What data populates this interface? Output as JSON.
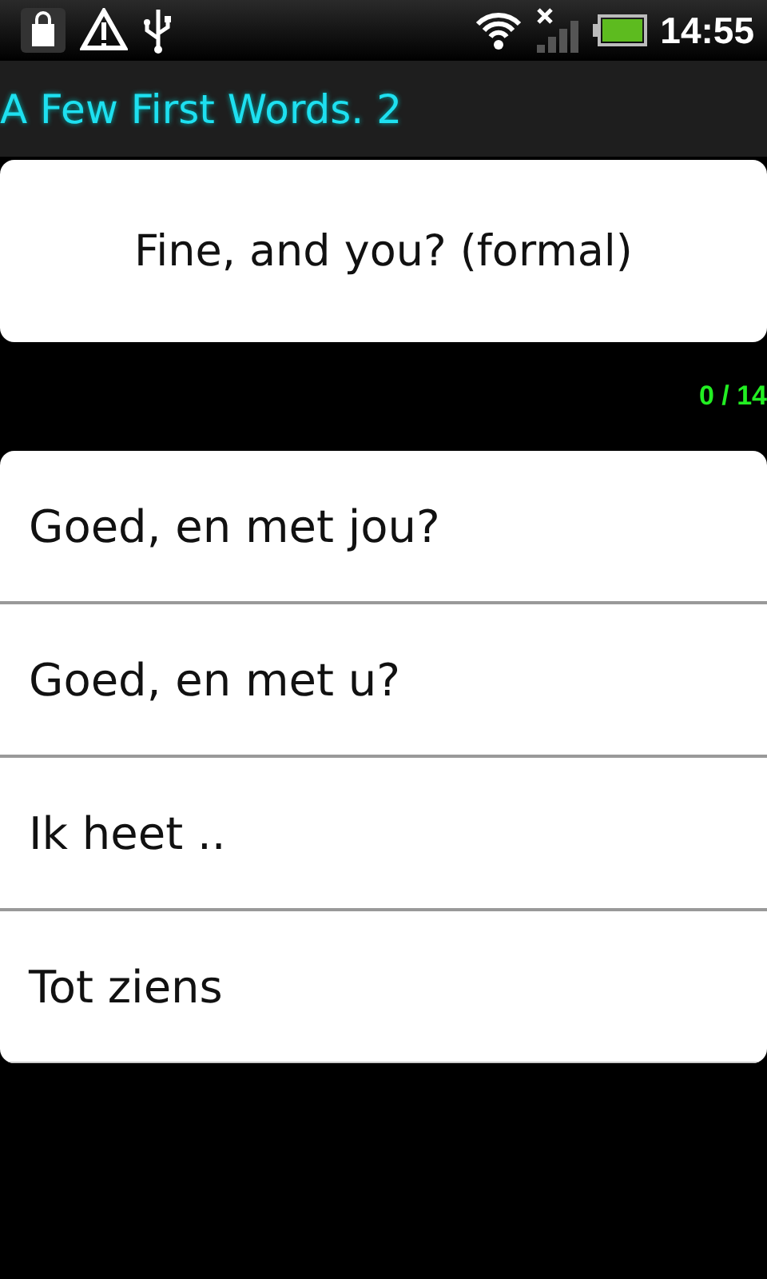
{
  "status_bar": {
    "time": "14:55"
  },
  "title": "A Few First Words. 2",
  "question": "Fine, and you? (formal)",
  "progress": "0 / 14",
  "options": [
    {
      "text": "Goed, en met jou?"
    },
    {
      "text": "Goed, en met u?"
    },
    {
      "text": "Ik heet .."
    },
    {
      "text": "Tot ziens"
    }
  ]
}
